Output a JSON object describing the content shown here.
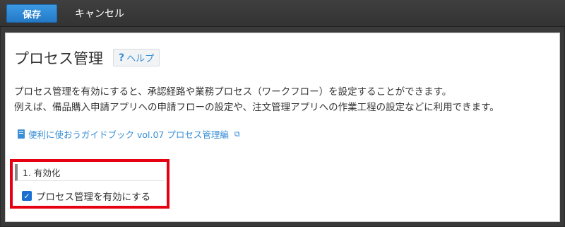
{
  "toolbar": {
    "save_label": "保存",
    "cancel_label": "キャンセル"
  },
  "page": {
    "title": "プロセス管理",
    "help_icon": "?",
    "help_label": "ヘルプ"
  },
  "description": {
    "line1": "プロセス管理を有効にすると、承認経路や業務プロセス（ワークフロー）を設定することができます。",
    "line2": "例えば、備品購入申請アプリへの申請フローの設定や、注文管理アプリへの作業工程の設定などに利用できます。"
  },
  "guide_link": {
    "label": "便利に使おうガイドブック vol.07 プロセス管理編",
    "icon": "book-icon",
    "external_icon": "⧉"
  },
  "section": {
    "heading": "1. 有効化",
    "checkbox_label": "プロセス管理を有効にする",
    "checkbox_checked": true,
    "checkmark": "✓"
  },
  "colors": {
    "primary": "#2379c6",
    "link": "#3a8fd6",
    "highlight": "#e50012",
    "toolbar": "#3a3a3a"
  }
}
